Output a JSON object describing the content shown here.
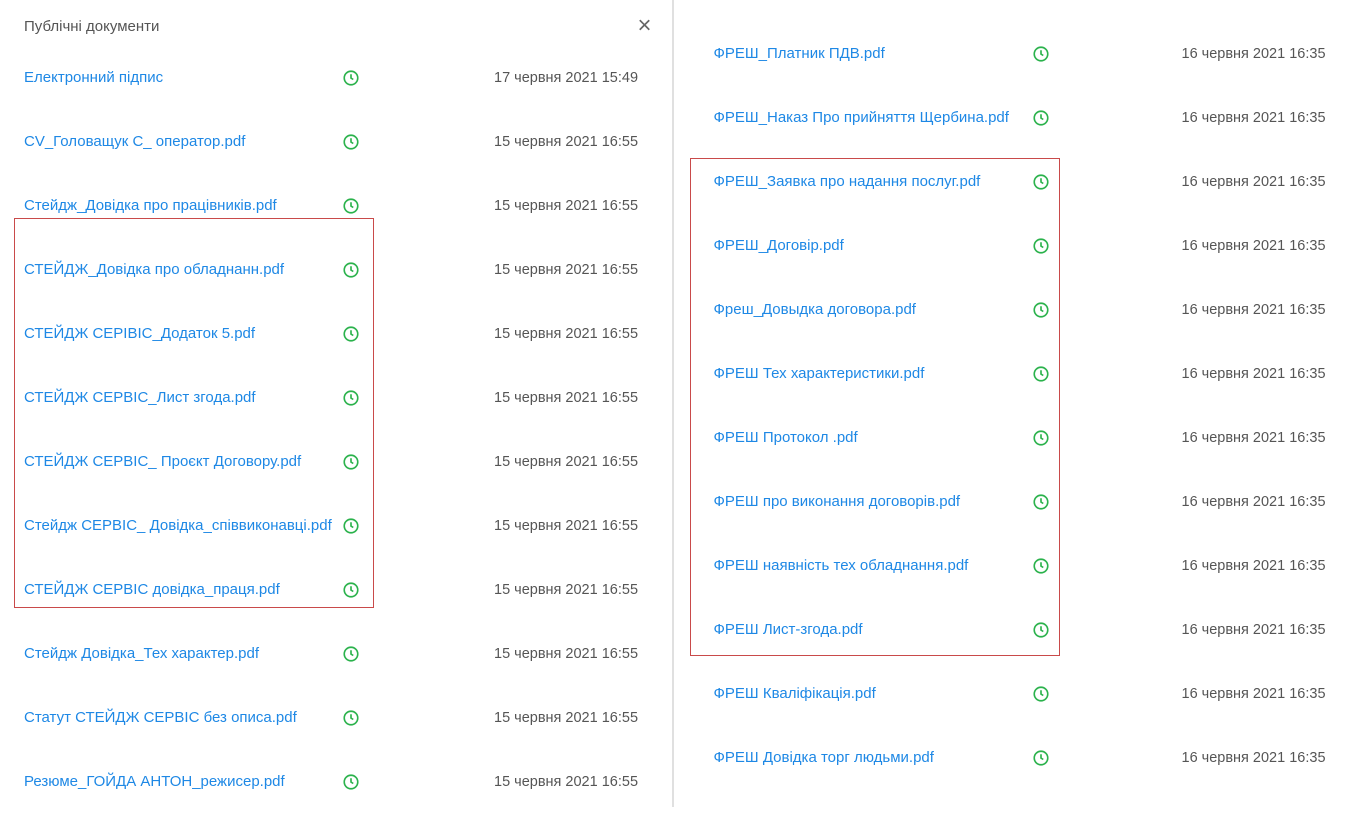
{
  "left": {
    "title": "Публічні документи",
    "docs": [
      {
        "name": "Електронний підпис",
        "date": "17 червня 2021 15:49"
      },
      {
        "name": "CV_Головащук С_ оператор.pdf",
        "date": "15 червня 2021 16:55"
      },
      {
        "name": "Стейдж_Довідка про працівників.pdf",
        "date": "15 червня 2021 16:55"
      },
      {
        "name": "СТЕЙДЖ_Довідка про обладнанн.pdf",
        "date": "15 червня 2021 16:55"
      },
      {
        "name": "СТЕЙДЖ СЕРІВІС_Додаток 5.pdf",
        "date": "15 червня 2021 16:55"
      },
      {
        "name": "СТЕЙДЖ СЕРВІС_Лист згода.pdf",
        "date": "15 червня 2021 16:55"
      },
      {
        "name": "СТЕЙДЖ СЕРВІС_ Проєкт Договору.pdf",
        "date": "15 червня 2021 16:55"
      },
      {
        "name": "Стейдж СЕРВІС_ Довідка_співвиконавці.pdf",
        "date": "15 червня 2021 16:55"
      },
      {
        "name": "СТЕЙДЖ СЕРВІС довідка_праця.pdf",
        "date": "15 червня 2021 16:55"
      },
      {
        "name": "Стейдж Довідка_Тех характер.pdf",
        "date": "15 червня 2021 16:55"
      },
      {
        "name": "Статут СТЕЙДЖ СЕРВІС без описа.pdf",
        "date": "15 червня 2021 16:55"
      },
      {
        "name": "Резюме_ГОЙДА АНТОН_режисер.pdf",
        "date": "15 червня 2021 16:55"
      }
    ]
  },
  "right": {
    "docs": [
      {
        "name": "ФРЕШ_Платник ПДВ.pdf",
        "date": "16 червня 2021 16:35"
      },
      {
        "name": "ФРЕШ_Наказ Про прийняття Щербина.pdf",
        "date": "16 червня 2021 16:35"
      },
      {
        "name": "ФРЕШ_Заявка про надання послуг.pdf",
        "date": "16 червня 2021 16:35"
      },
      {
        "name": "ФРЕШ_Договір.pdf",
        "date": "16 червня 2021 16:35"
      },
      {
        "name": "Фреш_Довыдка договора.pdf",
        "date": "16 червня 2021 16:35"
      },
      {
        "name": "ФРЕШ Тех характеристики.pdf",
        "date": "16 червня 2021 16:35"
      },
      {
        "name": "ФРЕШ Протокол .pdf",
        "date": "16 червня 2021 16:35"
      },
      {
        "name": "ФРЕШ про виконання договорів.pdf",
        "date": "16 червня 2021 16:35"
      },
      {
        "name": "ФРЕШ наявність тех обладнання.pdf",
        "date": "16 червня 2021 16:35"
      },
      {
        "name": "ФРЕШ Лист-згода.pdf",
        "date": "16 червня 2021 16:35"
      },
      {
        "name": "ФРЕШ Кваліфікація.pdf",
        "date": "16 червня 2021 16:35"
      },
      {
        "name": "ФРЕШ Довідка торг людьми.pdf",
        "date": "16 червня 2021 16:35"
      }
    ]
  }
}
